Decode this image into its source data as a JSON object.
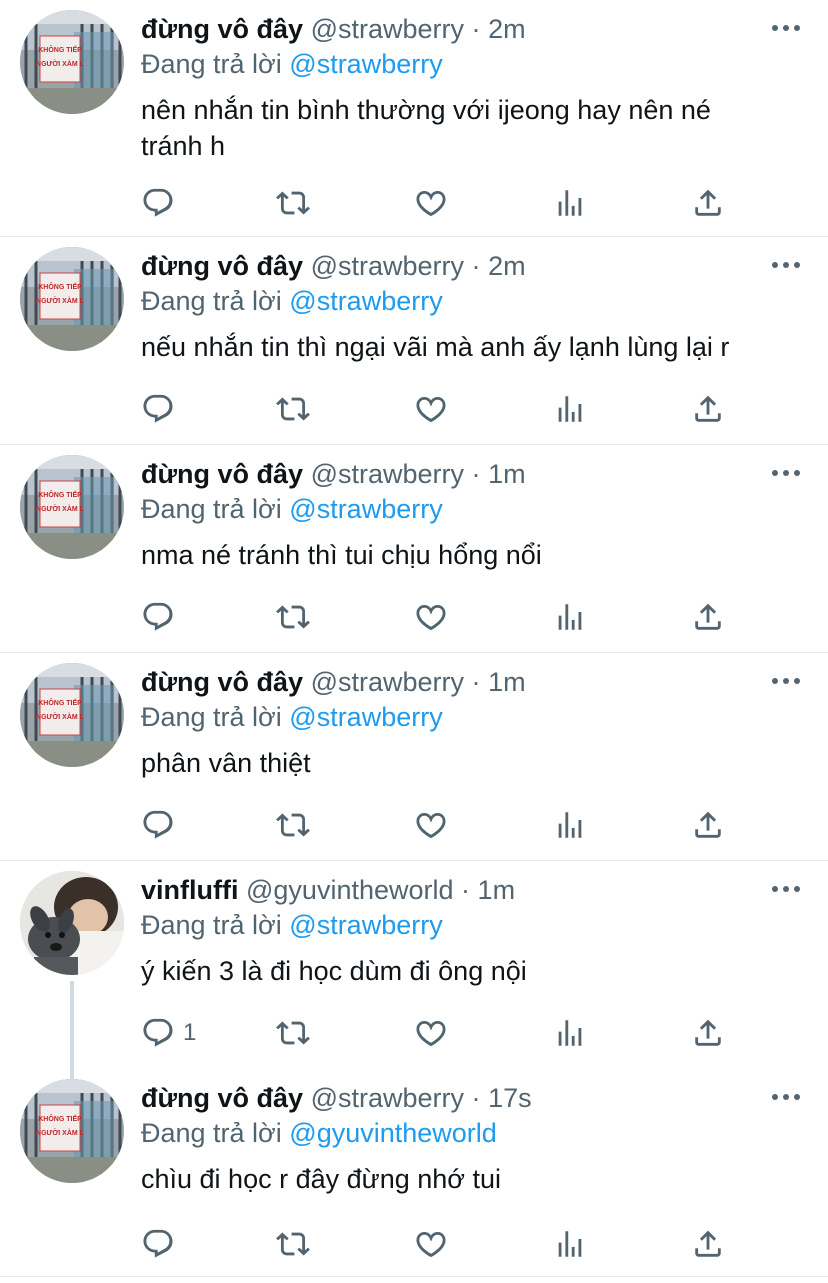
{
  "colors": {
    "accent": "#1d9bf0",
    "muted": "#536471",
    "text": "#0f1419"
  },
  "tweets": [
    {
      "name": "đừng vô đây",
      "handle": "@strawberry",
      "dot": "·",
      "time": "2m",
      "replying_label": "Đang trả lời",
      "replying_to": "@strawberry",
      "text": "nên nhắn tin bình thường với ijeong hay nên né tránh h",
      "reply_count": ""
    },
    {
      "name": "đừng vô đây",
      "handle": "@strawberry",
      "dot": "·",
      "time": "2m",
      "replying_label": "Đang trả lời",
      "replying_to": "@strawberry",
      "text": "nếu nhắn tin thì ngại vãi mà anh ấy lạnh lùng lại r",
      "reply_count": ""
    },
    {
      "name": "đừng vô đây",
      "handle": "@strawberry",
      "dot": "·",
      "time": "1m",
      "replying_label": "Đang trả lời",
      "replying_to": "@strawberry",
      "text": "nma né tránh thì tui chịu hổng nổi",
      "reply_count": ""
    },
    {
      "name": "đừng vô đây",
      "handle": "@strawberry",
      "dot": "·",
      "time": "1m",
      "replying_label": "Đang trả lời",
      "replying_to": "@strawberry",
      "text": "phân vân thiệt",
      "reply_count": ""
    },
    {
      "name": "vinfluffi",
      "handle": "@gyuvintheworld",
      "dot": "·",
      "time": "1m",
      "replying_label": "Đang trả lời",
      "replying_to": "@strawberry",
      "text": "ý kiến 3 là đi học dùm đi ông nội",
      "reply_count": "1"
    },
    {
      "name": "đừng vô đây",
      "handle": "@strawberry",
      "dot": "·",
      "time": "17s",
      "replying_label": "Đang trả lời",
      "replying_to": "@gyuvintheworld",
      "text": "chìu đi học r đây đừng nhớ tui",
      "reply_count": ""
    }
  ],
  "icons": {
    "reply": "reply-icon",
    "retweet": "retweet-icon",
    "like": "heart-icon",
    "analytics": "analytics-icon",
    "share": "share-icon",
    "more": "more-icon"
  },
  "avatars": {
    "sign_line1": "KHÔNG TIẾP",
    "sign_line2": "NGƯỜI XÀM L"
  }
}
